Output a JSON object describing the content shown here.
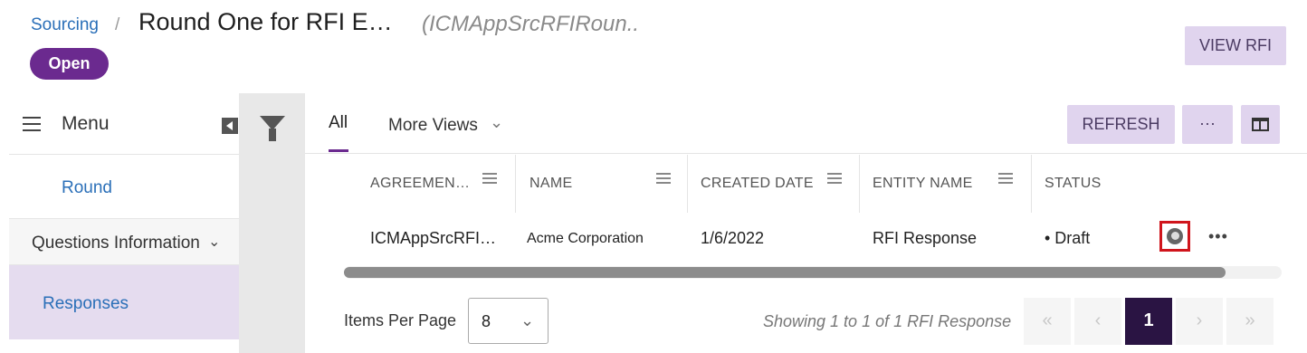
{
  "header": {
    "breadcrumb": "Sourcing",
    "separator": "/",
    "title": "Round One for RFI E…",
    "subtitle": "(ICMAppSrcRFIRoun..",
    "status": "Open",
    "view_button": "VIEW RFI"
  },
  "sidebar": {
    "menu_label": "Menu",
    "items": [
      {
        "label": "Round"
      },
      {
        "label": "Questions Information"
      },
      {
        "label": "Responses"
      }
    ]
  },
  "toolbar": {
    "tab_all": "All",
    "tab_more": "More Views",
    "refresh": "REFRESH",
    "more": "···"
  },
  "table": {
    "columns": [
      "AGREEMEN…",
      "NAME",
      "CREATED DATE",
      "ENTITY NAME",
      "STATUS"
    ],
    "rows": [
      {
        "agreement": "ICMAppSrcRFI…",
        "name": "Acme Corporation",
        "created_date": "1/6/2022",
        "entity_name": "RFI Response",
        "status": "• Draft",
        "actions": "•••"
      }
    ]
  },
  "pager": {
    "items_per_page_label": "Items Per Page",
    "items_per_page_value": "8",
    "info": "Showing 1 to 1 of 1 RFI Response",
    "first": "«",
    "prev": "‹",
    "current_page": "1",
    "next": "›",
    "last": "»"
  },
  "horizontal_scroll_position": 0.94,
  "colors": {
    "accent": "#6b2a8f",
    "button_bg": "#e0d4ee",
    "link": "#2a6fb8",
    "highlight": "#d0151c"
  }
}
